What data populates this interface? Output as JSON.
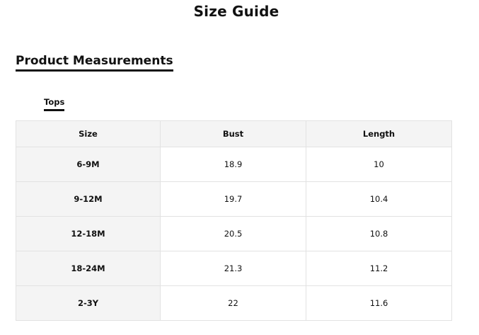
{
  "header": {
    "title": "Size Guide"
  },
  "section": {
    "title": "Product Measurements"
  },
  "tabs": [
    {
      "label": "Tops",
      "active": true
    }
  ],
  "table": {
    "columns": [
      "Size",
      "Bust",
      "Length"
    ],
    "rows": [
      [
        "6-9M",
        "18.9",
        "10"
      ],
      [
        "9-12M",
        "19.7",
        "10.4"
      ],
      [
        "12-18M",
        "20.5",
        "10.8"
      ],
      [
        "18-24M",
        "21.3",
        "11.2"
      ],
      [
        "2-3Y",
        "22",
        "11.6"
      ]
    ]
  }
}
